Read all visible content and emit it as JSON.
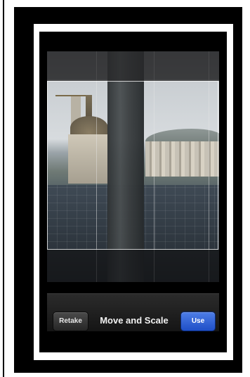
{
  "screen": {
    "title": "Move and Scale"
  },
  "toolbar": {
    "retake_label": "Retake",
    "use_label": "Use"
  },
  "colors": {
    "use_button": "#1f4fc7",
    "toolbar_bg": "#151515",
    "frame": "#000000",
    "mat": "#ffffff"
  }
}
